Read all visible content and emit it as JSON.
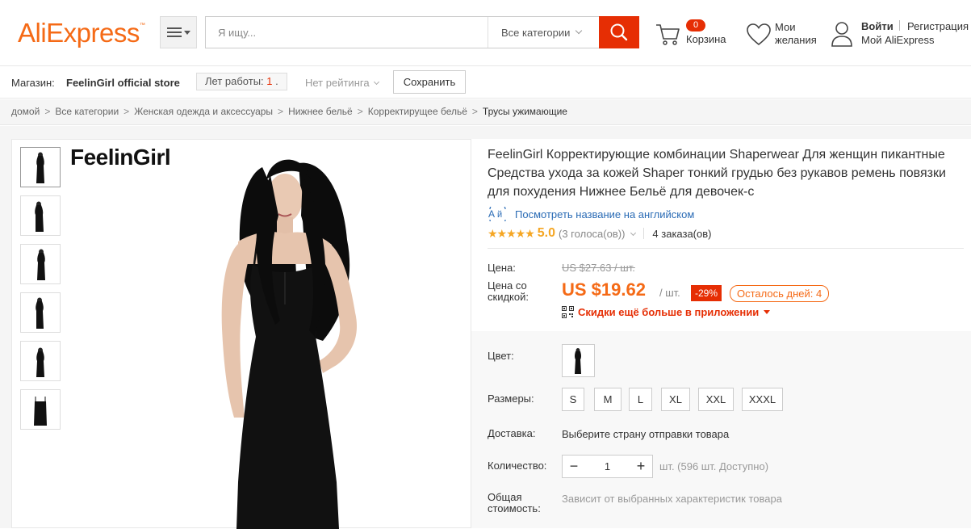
{
  "header": {
    "logo": "AliExpress",
    "search_placeholder": "Я ищу...",
    "category_label": "Все категории",
    "cart_count": "0",
    "cart_label": "Корзина",
    "wishlist_line1": "Мои",
    "wishlist_line2": "желания",
    "login_label": "Войти",
    "register_label": "Регистрация",
    "my_ali_label": "Мой AliExpress"
  },
  "store": {
    "shop_label": "Магазин:",
    "shop_name": "FeelinGirl official store",
    "years_label": "Лет работы:",
    "years_value": "1",
    "rating_label": "Нет рейтинга",
    "save_label": "Сохранить"
  },
  "breadcrumb": [
    "домой",
    "Все категории",
    "Женская одежда и аксессуары",
    "Нижнее бельё",
    "Корректирущее бельё",
    "Трусы ужимающие"
  ],
  "gallery": {
    "brand": "FeelinGirl"
  },
  "product": {
    "title": "FeelinGirl Корректирующие комбинации Shaperwear Для женщин пикантные Средства ухода за кожей Shaper тонкий грудью без рукавов ремень повязки для похудения Нижнее Бельё для девочек-с",
    "translate_link": "Посмотреть название на английском",
    "score": "5.0",
    "votes": "(3 голоса(ов))",
    "orders": "4 заказа(ов)",
    "price_label": "Цена:",
    "old_price": "US $27.63 / шт.",
    "discount_label": "Цена со скидкой:",
    "new_price": "US $19.62",
    "unit": "/ шт.",
    "discount_pct": "-29%",
    "days_left": "Осталось дней: 4",
    "app_promo": "Скидки ещё больше в приложении"
  },
  "options": {
    "color_label": "Цвет:",
    "sizes_label": "Размеры:",
    "sizes": [
      "S",
      "M",
      "L",
      "XL",
      "XXL",
      "XXXL"
    ],
    "shipping_label": "Доставка:",
    "shipping_value": "Выберите страну отправки товара",
    "qty_label": "Количество:",
    "qty_value": "1",
    "qty_minus": "−",
    "qty_plus": "+",
    "availability": "шт. (596 шт. Доступно)",
    "total_label_1": "Общая",
    "total_label_2": "стоимость:",
    "total_value": "Зависит от выбранных характеристик товара"
  },
  "colors": {
    "brand_orange": "#f56a16",
    "brand_red": "#e62e04",
    "link_blue": "#2a6bb5",
    "star": "#f5a623"
  }
}
